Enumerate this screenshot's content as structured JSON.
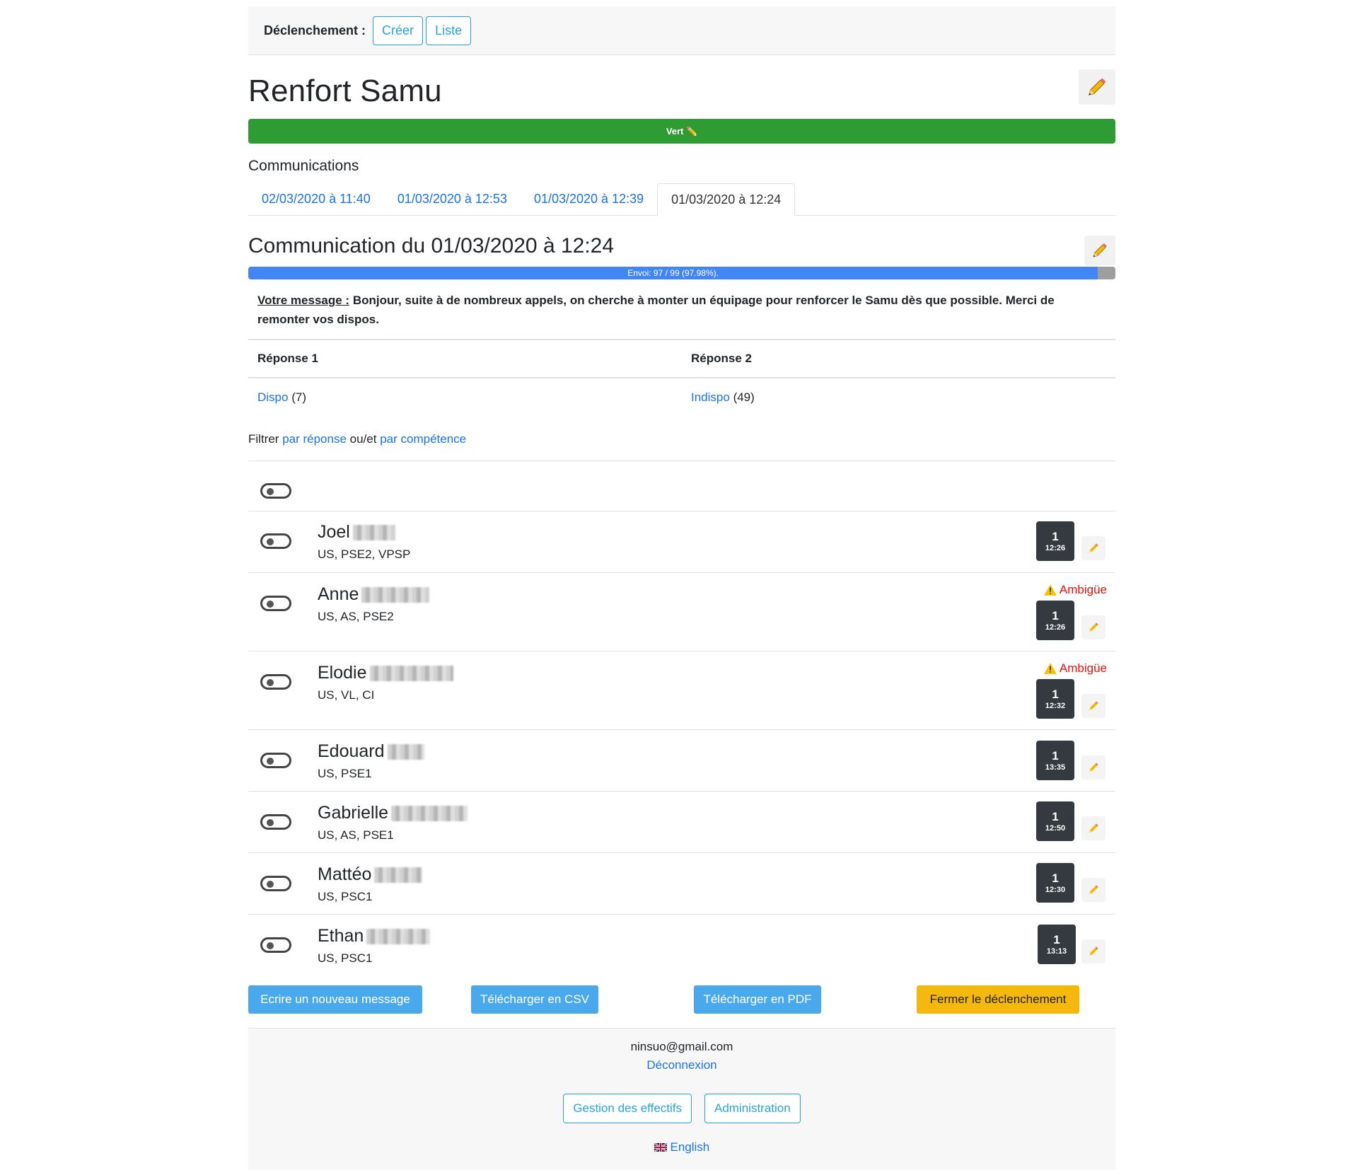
{
  "topbar": {
    "label": "Déclenchement :",
    "create_label": "Créer",
    "list_label": "Liste"
  },
  "page": {
    "title": "Renfort Samu",
    "status_text": "Vert ✏️",
    "status_color": "#2e9b33"
  },
  "communications": {
    "label": "Communications",
    "tabs": [
      {
        "label": "02/03/2020 à 11:40"
      },
      {
        "label": "01/03/2020 à 12:53"
      },
      {
        "label": "01/03/2020 à 12:39"
      },
      {
        "label": "01/03/2020 à 12:24"
      }
    ],
    "active_tab": 3
  },
  "communication": {
    "title": "Communication du 01/03/2020 à 12:24",
    "progress_text": "Envoi: 97 / 99 (97.98%).",
    "progress_fraction": 0.9798,
    "message_label": "Votre message :",
    "message_text": "Bonjour, suite à de nombreux appels, on cherche à monter un équipage pour renforcer le Samu dès que possible. Merci de remonter vos dispos."
  },
  "responses": {
    "headers": [
      "Réponse 1",
      "Réponse 2"
    ],
    "r1_link": "Dispo",
    "r1_count": "(7)",
    "r2_link": "Indispo",
    "r2_count": "(49)"
  },
  "filter": {
    "prefix": "Filtrer",
    "by_response": "par réponse",
    "andor": "ou/et",
    "by_skill": "par compétence"
  },
  "people": [
    {
      "name": "Joel",
      "skills": "US, PSE2, VPSP",
      "count": "1",
      "time": "12:26",
      "ambiguous": ""
    },
    {
      "name": "Anne",
      "skills": "US, AS, PSE2",
      "count": "1",
      "time": "12:26",
      "ambiguous": "Ambigüe"
    },
    {
      "name": "Elodie",
      "skills": "US, VL, CI",
      "count": "1",
      "time": "12:32",
      "ambiguous": "Ambigüe"
    },
    {
      "name": "Edouard",
      "skills": "US, PSE1",
      "count": "1",
      "time": "13:35",
      "ambiguous": ""
    },
    {
      "name": "Gabrielle",
      "skills": "US, AS, PSE1",
      "count": "1",
      "time": "12:50",
      "ambiguous": ""
    },
    {
      "name": "Mattéo",
      "skills": "US, PSC1",
      "count": "1",
      "time": "12:30",
      "ambiguous": ""
    },
    {
      "name": "Ethan",
      "skills": "US, PSC1",
      "count": "1",
      "time": "13:13",
      "ambiguous": ""
    }
  ],
  "actions": {
    "new_message": "Ecrire un nouveau message",
    "csv": "Télécharger en CSV",
    "pdf": "Télécharger en PDF",
    "close": "Fermer le déclenchement"
  },
  "footer": {
    "email": "ninsuo@gmail.com",
    "logout": "Déconnexion",
    "staff": "Gestion des effectifs",
    "admin": "Administration",
    "language": "English"
  },
  "icons": {
    "edit": "pencil-icon",
    "warning": "warning-icon",
    "flag": "uk-flag-icon"
  }
}
